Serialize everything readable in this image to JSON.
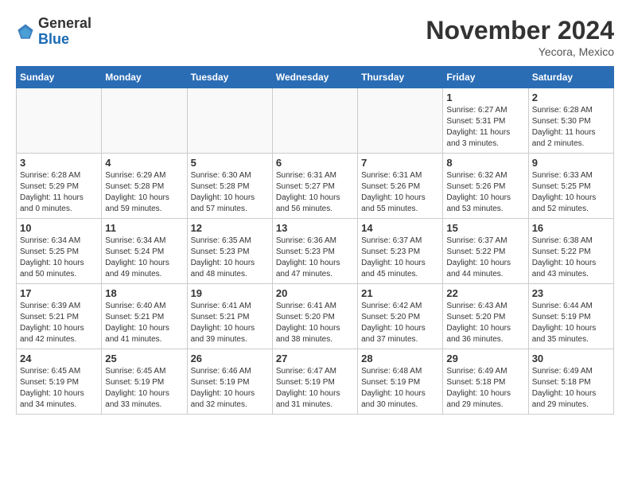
{
  "logo": {
    "general": "General",
    "blue": "Blue"
  },
  "header": {
    "month": "November 2024",
    "location": "Yecora, Mexico"
  },
  "weekdays": [
    "Sunday",
    "Monday",
    "Tuesday",
    "Wednesday",
    "Thursday",
    "Friday",
    "Saturday"
  ],
  "weeks": [
    [
      {
        "day": "",
        "empty": true
      },
      {
        "day": "",
        "empty": true
      },
      {
        "day": "",
        "empty": true
      },
      {
        "day": "",
        "empty": true
      },
      {
        "day": "",
        "empty": true
      },
      {
        "day": "1",
        "sunrise": "6:27 AM",
        "sunset": "5:31 PM",
        "daylight": "11 hours and 3 minutes."
      },
      {
        "day": "2",
        "sunrise": "6:28 AM",
        "sunset": "5:30 PM",
        "daylight": "11 hours and 2 minutes."
      }
    ],
    [
      {
        "day": "3",
        "sunrise": "6:28 AM",
        "sunset": "5:29 PM",
        "daylight": "11 hours and 0 minutes."
      },
      {
        "day": "4",
        "sunrise": "6:29 AM",
        "sunset": "5:28 PM",
        "daylight": "10 hours and 59 minutes."
      },
      {
        "day": "5",
        "sunrise": "6:30 AM",
        "sunset": "5:28 PM",
        "daylight": "10 hours and 57 minutes."
      },
      {
        "day": "6",
        "sunrise": "6:31 AM",
        "sunset": "5:27 PM",
        "daylight": "10 hours and 56 minutes."
      },
      {
        "day": "7",
        "sunrise": "6:31 AM",
        "sunset": "5:26 PM",
        "daylight": "10 hours and 55 minutes."
      },
      {
        "day": "8",
        "sunrise": "6:32 AM",
        "sunset": "5:26 PM",
        "daylight": "10 hours and 53 minutes."
      },
      {
        "day": "9",
        "sunrise": "6:33 AM",
        "sunset": "5:25 PM",
        "daylight": "10 hours and 52 minutes."
      }
    ],
    [
      {
        "day": "10",
        "sunrise": "6:34 AM",
        "sunset": "5:25 PM",
        "daylight": "10 hours and 50 minutes."
      },
      {
        "day": "11",
        "sunrise": "6:34 AM",
        "sunset": "5:24 PM",
        "daylight": "10 hours and 49 minutes."
      },
      {
        "day": "12",
        "sunrise": "6:35 AM",
        "sunset": "5:23 PM",
        "daylight": "10 hours and 48 minutes."
      },
      {
        "day": "13",
        "sunrise": "6:36 AM",
        "sunset": "5:23 PM",
        "daylight": "10 hours and 47 minutes."
      },
      {
        "day": "14",
        "sunrise": "6:37 AM",
        "sunset": "5:23 PM",
        "daylight": "10 hours and 45 minutes."
      },
      {
        "day": "15",
        "sunrise": "6:37 AM",
        "sunset": "5:22 PM",
        "daylight": "10 hours and 44 minutes."
      },
      {
        "day": "16",
        "sunrise": "6:38 AM",
        "sunset": "5:22 PM",
        "daylight": "10 hours and 43 minutes."
      }
    ],
    [
      {
        "day": "17",
        "sunrise": "6:39 AM",
        "sunset": "5:21 PM",
        "daylight": "10 hours and 42 minutes."
      },
      {
        "day": "18",
        "sunrise": "6:40 AM",
        "sunset": "5:21 PM",
        "daylight": "10 hours and 41 minutes."
      },
      {
        "day": "19",
        "sunrise": "6:41 AM",
        "sunset": "5:21 PM",
        "daylight": "10 hours and 39 minutes."
      },
      {
        "day": "20",
        "sunrise": "6:41 AM",
        "sunset": "5:20 PM",
        "daylight": "10 hours and 38 minutes."
      },
      {
        "day": "21",
        "sunrise": "6:42 AM",
        "sunset": "5:20 PM",
        "daylight": "10 hours and 37 minutes."
      },
      {
        "day": "22",
        "sunrise": "6:43 AM",
        "sunset": "5:20 PM",
        "daylight": "10 hours and 36 minutes."
      },
      {
        "day": "23",
        "sunrise": "6:44 AM",
        "sunset": "5:19 PM",
        "daylight": "10 hours and 35 minutes."
      }
    ],
    [
      {
        "day": "24",
        "sunrise": "6:45 AM",
        "sunset": "5:19 PM",
        "daylight": "10 hours and 34 minutes."
      },
      {
        "day": "25",
        "sunrise": "6:45 AM",
        "sunset": "5:19 PM",
        "daylight": "10 hours and 33 minutes."
      },
      {
        "day": "26",
        "sunrise": "6:46 AM",
        "sunset": "5:19 PM",
        "daylight": "10 hours and 32 minutes."
      },
      {
        "day": "27",
        "sunrise": "6:47 AM",
        "sunset": "5:19 PM",
        "daylight": "10 hours and 31 minutes."
      },
      {
        "day": "28",
        "sunrise": "6:48 AM",
        "sunset": "5:19 PM",
        "daylight": "10 hours and 30 minutes."
      },
      {
        "day": "29",
        "sunrise": "6:49 AM",
        "sunset": "5:18 PM",
        "daylight": "10 hours and 29 minutes."
      },
      {
        "day": "30",
        "sunrise": "6:49 AM",
        "sunset": "5:18 PM",
        "daylight": "10 hours and 29 minutes."
      }
    ]
  ]
}
